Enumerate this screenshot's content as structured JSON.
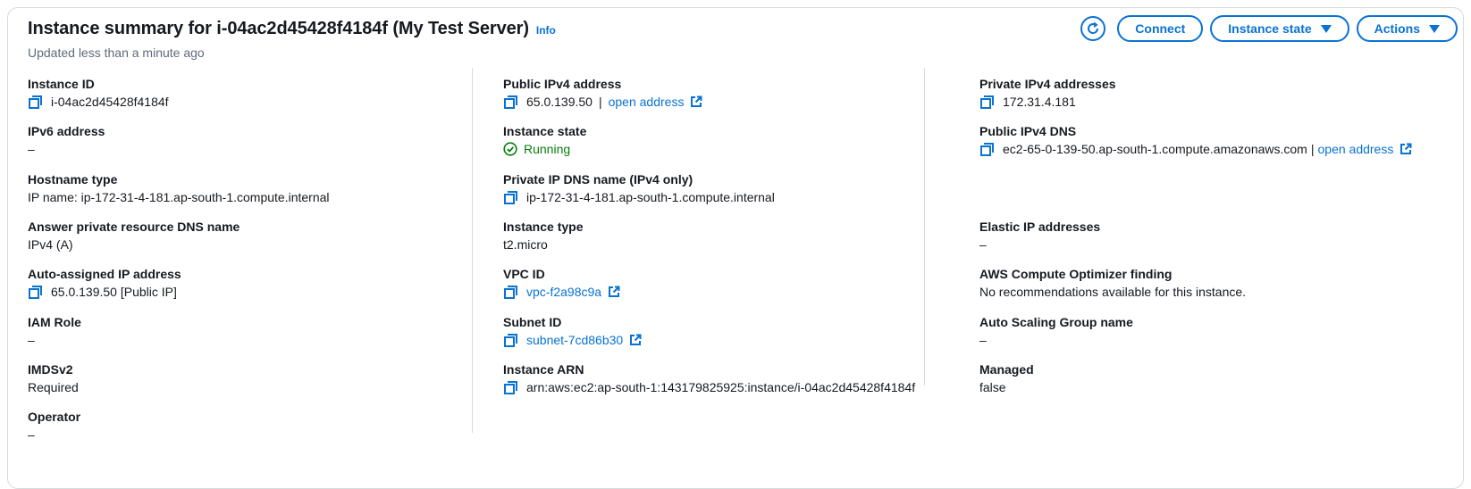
{
  "header": {
    "title": "Instance summary for i-04ac2d45428f4184f (My Test Server)",
    "info": "Info",
    "updated": "Updated less than a minute ago"
  },
  "actions": {
    "connect": "Connect",
    "instance_state": "Instance state",
    "actions": "Actions"
  },
  "col1": {
    "instance_id_label": "Instance ID",
    "instance_id": "i-04ac2d45428f4184f",
    "ipv6_label": "IPv6 address",
    "ipv6": "–",
    "hostname_label": "Hostname type",
    "hostname": "IP name: ip-172-31-4-181.ap-south-1.compute.internal",
    "answer_dns_label": "Answer private resource DNS name",
    "answer_dns": "IPv4 (A)",
    "auto_ip_label": "Auto-assigned IP address",
    "auto_ip": "65.0.139.50 [Public IP]",
    "iam_label": "IAM Role",
    "iam": "–",
    "imds_label": "IMDSv2",
    "imds": "Required",
    "operator_label": "Operator",
    "operator": "–"
  },
  "col2": {
    "public_ipv4_label": "Public IPv4 address",
    "public_ipv4": "65.0.139.50",
    "pipe": "|",
    "open_address": "open address",
    "state_label": "Instance state",
    "state": "Running",
    "private_dns_label": "Private IP DNS name (IPv4 only)",
    "private_dns": "ip-172-31-4-181.ap-south-1.compute.internal",
    "type_label": "Instance type",
    "type": "t2.micro",
    "vpc_label": "VPC ID",
    "vpc": "vpc-f2a98c9a",
    "subnet_label": "Subnet ID",
    "subnet": "subnet-7cd86b30",
    "arn_label": "Instance ARN",
    "arn": "arn:aws:ec2:ap-south-1:143179825925:instance/i-04ac2d45428f4184f"
  },
  "col3": {
    "private_ipv4_label": "Private IPv4 addresses",
    "private_ipv4": "172.31.4.181",
    "public_dns_label": "Public IPv4 DNS",
    "public_dns": "ec2-65-0-139-50.ap-south-1.compute.amazonaws.com",
    "pipe": "|",
    "open_address": "open address",
    "elastic_label": "Elastic IP addresses",
    "elastic": "–",
    "optimizer_label": "AWS Compute Optimizer finding",
    "optimizer": "No recommendations available for this instance.",
    "asg_label": "Auto Scaling Group name",
    "asg": "–",
    "managed_label": "Managed",
    "managed": "false"
  },
  "colors": {
    "link": "#0972d3",
    "success": "#037f0c",
    "border": "#d5dbdb",
    "muted": "#5f6b7a"
  },
  "icons": [
    "copy-icon",
    "external-link-icon",
    "refresh-icon",
    "caret-down-icon",
    "status-ok-icon"
  ]
}
